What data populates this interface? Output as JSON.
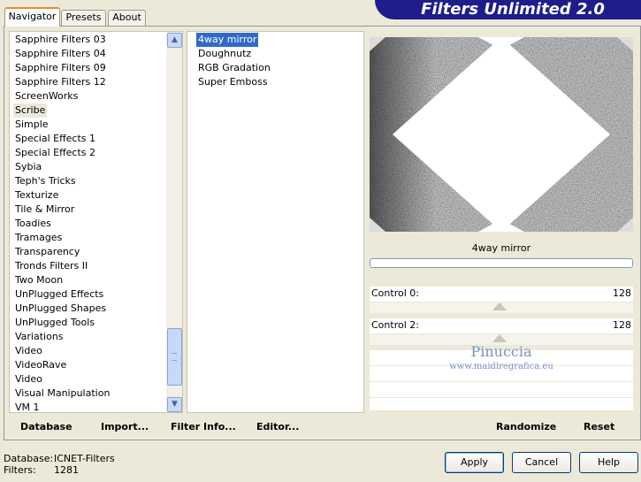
{
  "header": {
    "title": "Filters Unlimited 2.0"
  },
  "tabs": [
    {
      "label": "Navigator",
      "active": true
    },
    {
      "label": "Presets",
      "active": false
    },
    {
      "label": "About",
      "active": false
    }
  ],
  "categories": {
    "items": [
      "Sapphire Filters 03",
      "Sapphire Filters 04",
      "Sapphire Filters 09",
      "Sapphire Filters 12",
      "ScreenWorks",
      "Scribe",
      "Simple",
      "Special Effects 1",
      "Special Effects 2",
      "Sybia",
      "Teph's Tricks",
      "Texturize",
      "Tile & Mirror",
      "Toadies",
      "Tramages",
      "Transparency",
      "Tronds Filters II",
      "Two Moon",
      "UnPlugged Effects",
      "UnPlugged Shapes",
      "UnPlugged Tools",
      "Variations",
      "Video",
      "VideoRave",
      "Video",
      "Visual Manipulation",
      "VM 1"
    ],
    "selected": "Scribe"
  },
  "filters": {
    "items": [
      "4way mirror",
      "Doughnutz",
      "RGB Gradation",
      "Super Emboss"
    ],
    "selected": "4way mirror"
  },
  "preview": {
    "filter_name": "4way mirror",
    "progress": 0,
    "controls": [
      {
        "label": "Control 0:",
        "value": "128"
      },
      {
        "label": "Control 2:",
        "value": "128"
      }
    ]
  },
  "watermark": {
    "name": "Pinuccia",
    "url": "www.maidiregrafica.eu"
  },
  "toolbar": {
    "database": "Database",
    "import": "Import...",
    "filter_info": "Filter Info...",
    "editor": "Editor...",
    "randomize": "Randomize",
    "reset": "Reset"
  },
  "status": {
    "database_label": "Database:",
    "database_value": "ICNET-Filters",
    "filters_label": "Filters:",
    "filters_value": "1281"
  },
  "buttons": {
    "apply": "Apply",
    "cancel": "Cancel",
    "help": "Help"
  },
  "colors": {
    "banner": "#1d1d8c",
    "selection": "#316ac5",
    "tab_accent": "#e68b2c"
  }
}
